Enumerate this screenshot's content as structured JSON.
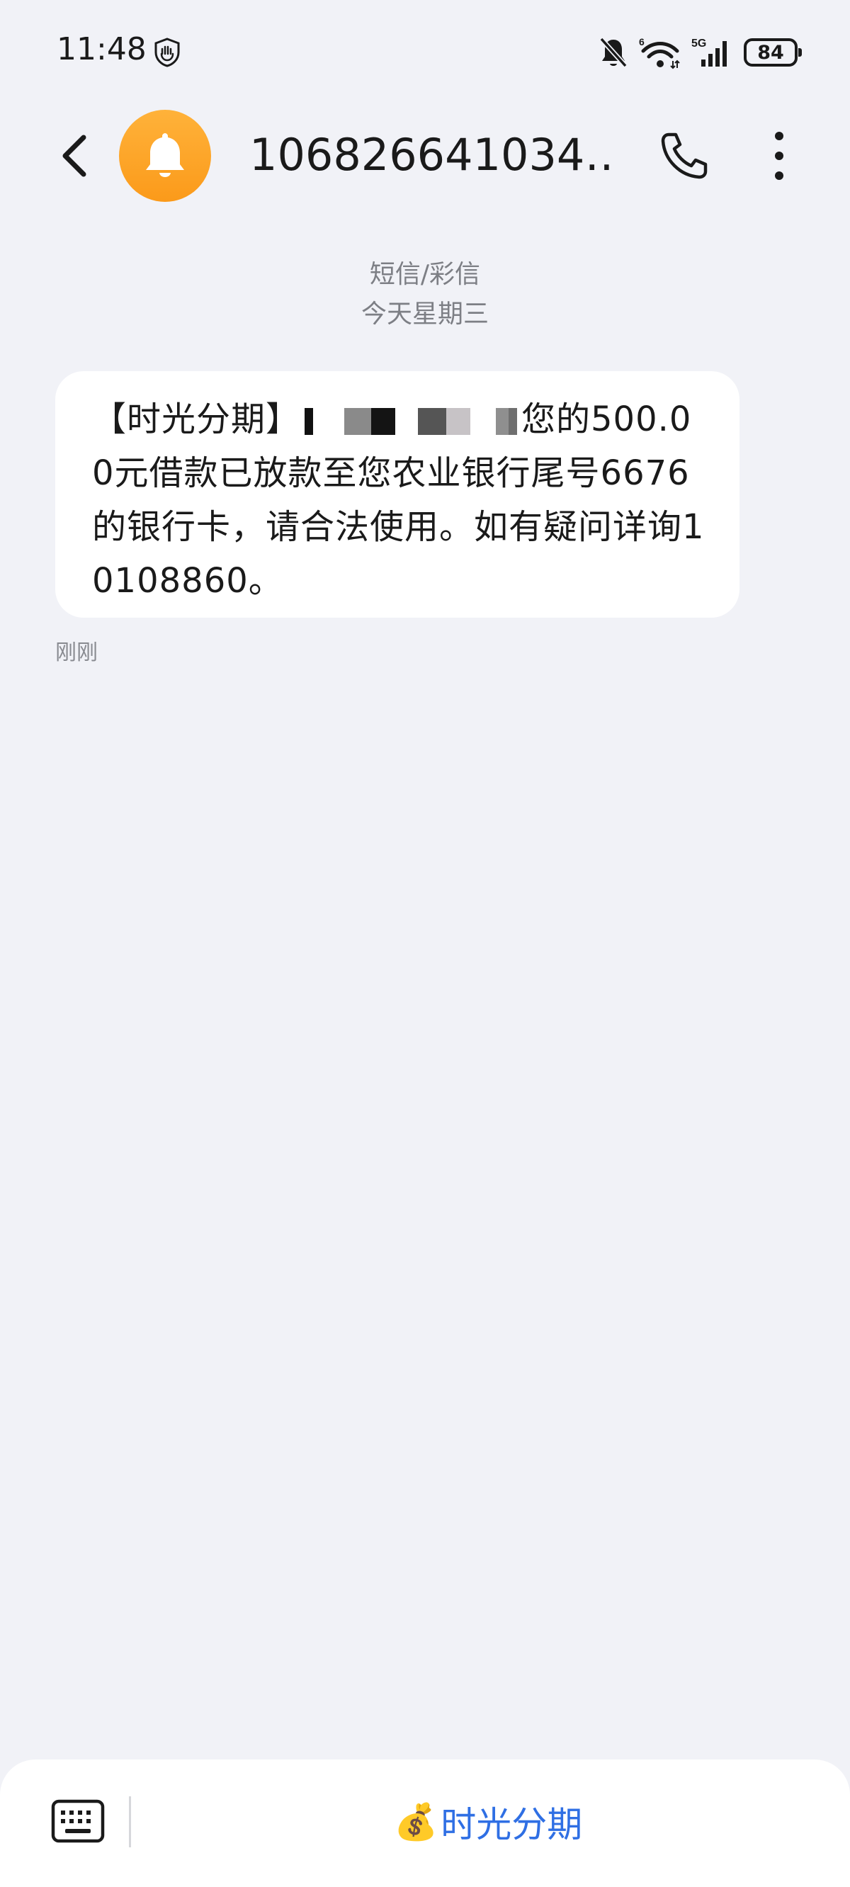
{
  "status_bar": {
    "time": "11:48",
    "battery": "84",
    "network_label": "5G",
    "wifi_badge": "6"
  },
  "header": {
    "contact_name": "106826641034…"
  },
  "thread": {
    "message_type": "短信/彩信",
    "date_label": "今天星期三"
  },
  "message": {
    "prefix": "【时光分期】",
    "body": "您的500.00元借款已放款至您农业银行尾号6676的银行卡，请合法使用。如有疑问详询10108860。",
    "time": "刚刚"
  },
  "input_bar": {
    "quick_reply_label": "时光分期"
  },
  "colors": {
    "background": "#f1f2f7",
    "avatar": "#fb9a1a",
    "accent": "#2f6fe4"
  }
}
